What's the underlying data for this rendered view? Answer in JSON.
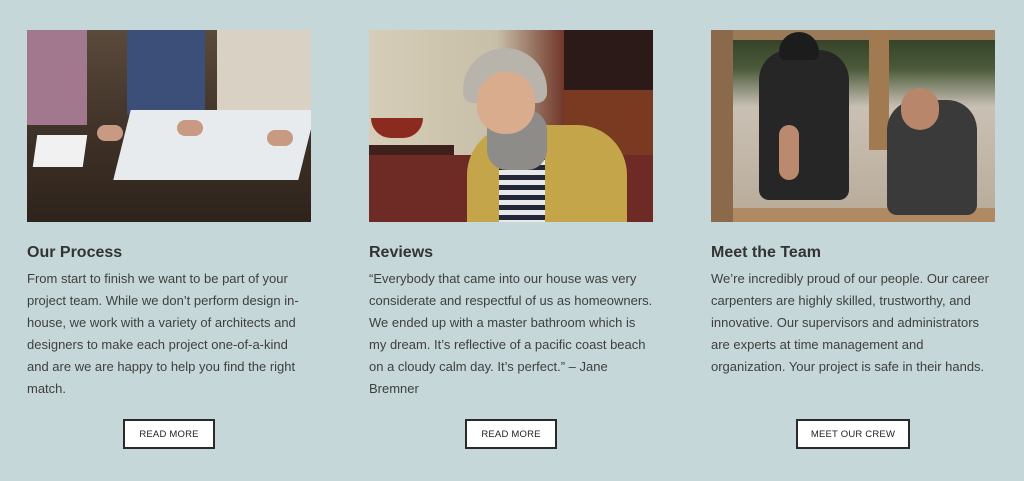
{
  "cards": [
    {
      "image_alt": "Our Process",
      "title": "Our Process",
      "text": "From start to finish we want to be part of your project team. While we don’t perform design in-house, we work with a variety of architects and designers to make each project one-of-a-kind and are we are happy to help you find the right match.",
      "button_label": "READ MORE"
    },
    {
      "image_alt": "Reviews",
      "title": "Reviews",
      "text": "“Everybody that came into our house was very considerate and respectful of us as homeowners. We ended up with a master bathroom which is my dream. It’s reflective of a pacific coast beach on a cloudy calm day. It’s perfect.” –  Jane Bremner",
      "button_label": "READ MORE"
    },
    {
      "image_alt": "Meet the Team",
      "title": "Meet the Team",
      "text": "We’re incredibly proud of our people. Our career carpenters are highly skilled, trustworthy, and innovative. Our supervisors and administrators are experts at time management and organization. Your project is safe in their hands.",
      "button_label": "MEET OUR CREW"
    }
  ],
  "colors": {
    "background": "#c5d7d8",
    "heading": "#333333",
    "body_text": "#3f3f3f",
    "button_border": "#2a2a2a",
    "button_bg": "#ffffff"
  }
}
